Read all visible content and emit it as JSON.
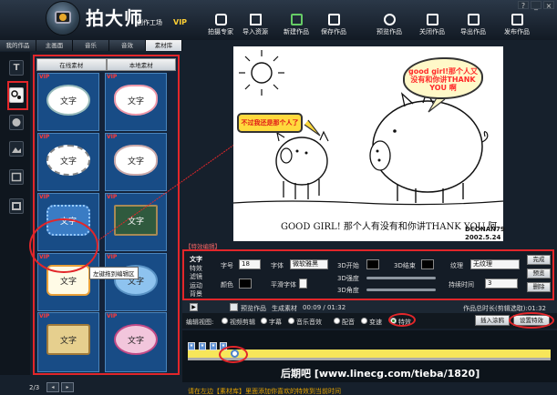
{
  "app": {
    "name": "拍大师",
    "subtitle": "创作工场",
    "vip": "VIP",
    "window_controls": [
      "?",
      "_",
      "×"
    ]
  },
  "toolbar": [
    {
      "label": "拍摄专家",
      "icon": "camera-icon"
    },
    {
      "label": "导入资源",
      "icon": "import-icon"
    },
    {
      "label": "新建作品",
      "icon": "new-icon"
    },
    {
      "label": "保存作品",
      "icon": "save-icon"
    },
    {
      "label": "预览作品",
      "icon": "eye-icon"
    },
    {
      "label": "关闭作品",
      "icon": "close-doc-icon"
    },
    {
      "label": "导出作品",
      "icon": "export-icon"
    },
    {
      "label": "发布作品",
      "icon": "upload-icon"
    }
  ],
  "tabs": [
    "我的作品",
    "主画面",
    "音乐",
    "音效",
    "素材库"
  ],
  "active_tab": "素材库",
  "tools": [
    "T",
    "bubble",
    "paint",
    "image",
    "frame",
    "picture"
  ],
  "library": {
    "subtabs": [
      "在线素材",
      "本地素材"
    ],
    "vip_badge": "VIP",
    "cell_text": "文字",
    "tooltip": "左键拖到编辑区",
    "page": "2/3",
    "prev": "◂",
    "next": "▸"
  },
  "stage": {
    "bubble1": "good girl!那个人又没有和你讲THANK YOU 啊",
    "bubble2": "不过我还是那个人了",
    "caption": "GOOD GIRL! 那个人有没有和你讲THANK YOU 阿",
    "author": "DCONAN79",
    "date": "2002.5.24"
  },
  "effects": {
    "panel_label": "【特效编辑】",
    "categories": [
      "文字",
      "特效",
      "滤镜",
      "运动",
      "背景"
    ],
    "active_category": "文字",
    "font_size_label": "字号",
    "font_size": "18",
    "font_label": "字体",
    "font": "微软雅黑",
    "color_label": "颜色",
    "smooth_label": "平滑字体",
    "start_3d_label": "3D开始",
    "end_3d_label": "3D结束",
    "intensity_3d_label": "3D强度",
    "angle_3d_label": "3D角度",
    "texture_label": "纹理",
    "texture": "无纹理",
    "duration_label": "持续时间",
    "duration": "3",
    "done": "完成",
    "preview": "预览",
    "delete": "删除"
  },
  "timeline": {
    "preview_label": "预览作品",
    "generate_label": "生成素材",
    "time": "00:09 / 01:32",
    "total_label": "作品总时长(剪辑选取):01:32",
    "view_label": "编辑视图:",
    "views": [
      "视频剪辑",
      "字幕",
      "音乐音效",
      "配音",
      "变速",
      "特效"
    ],
    "active_view": "特效",
    "insert_doodle": "插入涂鸦",
    "set_effect": "设置特效",
    "watermark": "后期吧  [www.linecg.com/tieba/1820]",
    "status": "请在左边【素材库】里面添加你喜欢的特效到当前时间"
  },
  "colors": {
    "accent": "#e2262a",
    "vip": "#ffcf33",
    "timeline_track": "#f7e65a",
    "status_text": "#e9a600"
  }
}
